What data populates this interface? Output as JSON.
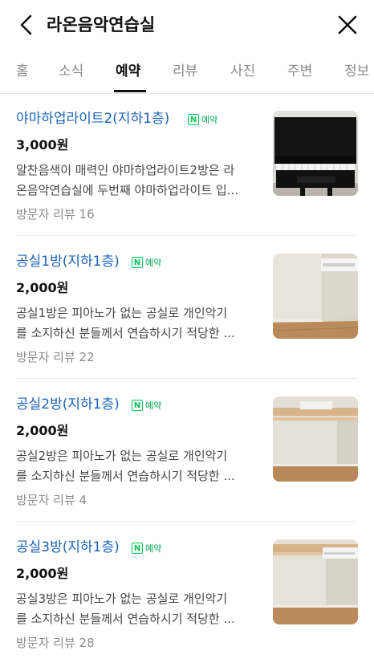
{
  "header": {
    "title": "라온음악연습실",
    "back_icon": "chevron-left-icon",
    "close_icon": "close-icon"
  },
  "tabs": [
    {
      "label": "홈"
    },
    {
      "label": "소식"
    },
    {
      "label": "예약",
      "active": true
    },
    {
      "label": "리뷰"
    },
    {
      "label": "사진"
    },
    {
      "label": "주변"
    },
    {
      "label": "정보"
    }
  ],
  "items": [
    {
      "title": "야마하업라이트2(지하1층)",
      "badge": "예약",
      "price": "3,000원",
      "desc_line1": "알찬음색이 매력인 야마하업라이트2방은 라",
      "desc_line2": "온음악연습실에 두번째 야마하업라이트 입...",
      "review": "방문자 리뷰 16"
    },
    {
      "title": "공실1방(지하1층)",
      "badge": "예약",
      "price": "2,000원",
      "desc_line1": "공실1방은 피아노가 없는 공실로 개인악기",
      "desc_line2": "를 소지하신 분들께서 연습하시기 적당한 ...",
      "review": "방문자 리뷰 22"
    },
    {
      "title": "공실2방(지하1층)",
      "badge": "예약",
      "price": "2,000원",
      "desc_line1": "공실2방은 피아노가 없는 공실로 개인악기",
      "desc_line2": "를 소지하신 분들께서 연습하시기 적당한 ...",
      "review": "방문자 리뷰 4"
    },
    {
      "title": "공실3방(지하1층)",
      "badge": "예약",
      "price": "2,000원",
      "desc_line1": "공실3방은 피아노가 없는 공실로 개인악기",
      "desc_line2": "를 소지하신 분들께서 연습하시기 적당한 ...",
      "review": "방문자 리뷰 28"
    }
  ],
  "colors": {
    "link": "#1a63b8",
    "naver_green": "#03c75a",
    "muted": "#8a8a8a"
  }
}
